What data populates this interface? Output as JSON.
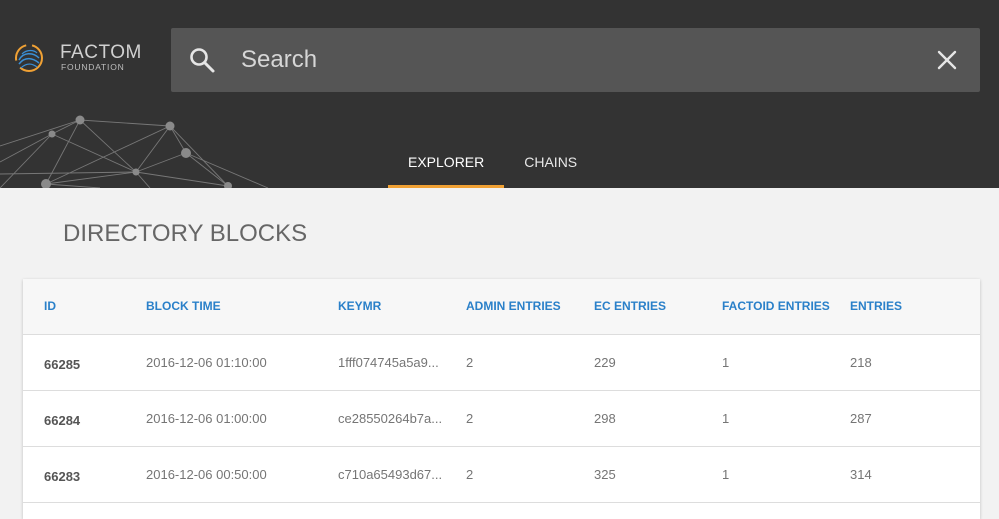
{
  "brand": {
    "name": "FACTOM",
    "subtitle": "FOUNDATION"
  },
  "search": {
    "placeholder": "Search",
    "value": ""
  },
  "tabs": [
    {
      "label": "EXPLORER",
      "active": true
    },
    {
      "label": "CHAINS",
      "active": false
    }
  ],
  "page": {
    "title": "DIRECTORY BLOCKS"
  },
  "table": {
    "columns": [
      "ID",
      "BLOCK TIME",
      "KEYMR",
      "ADMIN ENTRIES",
      "EC ENTRIES",
      "FACTOID ENTRIES",
      "ENTRIES"
    ],
    "rows": [
      {
        "id": "66285",
        "time": "2016-12-06 01:10:00",
        "keymr": "1fff074745a5a9...",
        "admin": "2",
        "ec": "229",
        "factoid": "1",
        "entries": "218"
      },
      {
        "id": "66284",
        "time": "2016-12-06 01:00:00",
        "keymr": "ce28550264b7a...",
        "admin": "2",
        "ec": "298",
        "factoid": "1",
        "entries": "287"
      },
      {
        "id": "66283",
        "time": "2016-12-06 00:50:00",
        "keymr": "c710a65493d67...",
        "admin": "2",
        "ec": "325",
        "factoid": "1",
        "entries": "314"
      }
    ]
  },
  "icons": {
    "logo": "factom-logo-icon",
    "search": "search-icon",
    "close": "close-icon"
  },
  "colors": {
    "header_bg": "#333333",
    "search_bg": "#555555",
    "tab_indicator": "#f0a134",
    "column_header": "#2a80c9",
    "page_bg": "#f2f2f2"
  }
}
